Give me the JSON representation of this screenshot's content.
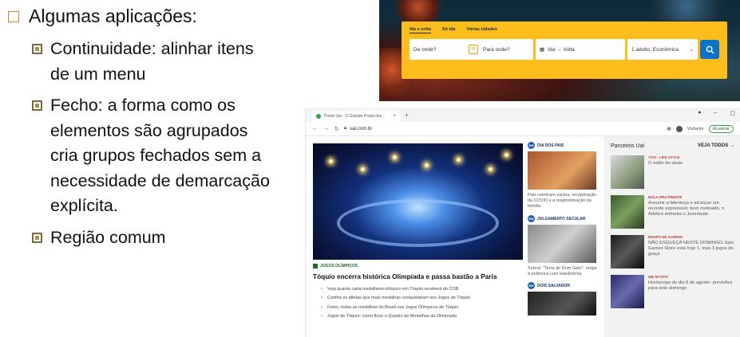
{
  "slide": {
    "heading": "Algumas aplicações:",
    "items": [
      "Continuidade: alinhar itens de um menu",
      "Fecho: a forma como os elementos são agrupados cria grupos fechados sem a necessidade de demarcação explícita.",
      "Região comum"
    ]
  },
  "flight": {
    "tabs": [
      "Ida e volta",
      "Só ida",
      "Várias cidades"
    ],
    "origin_placeholder": "De onde?",
    "destination_placeholder": "Para onde?",
    "dates_label": "Ida → Volta",
    "passengers_label": "1 adulto, Econômica",
    "swap_icon": "swap-icon",
    "search_icon": "search-icon",
    "accent": "#fdbe1d",
    "button_color": "#0a73c8"
  },
  "browser": {
    "tab_title": "Portal Uai - O Grande Portal dos...",
    "url": "uai.com.br",
    "profile_label": "Visitante",
    "update_label": "Atualizar",
    "hero_tag": "JOGOS OLÍMPICOS",
    "headline": "Tóquio encerra histórica Olimpíada e passa bastão a Paris",
    "related": [
      "Veja quanto cada medalhista olímpico em Tóquio receberá do COB",
      "Confira os atletas que mais medalhas conquistaram nos Jogos de Tóquio",
      "Fotos: todas as medalhas do Brasil nos Jogos Olímpicos de Tóquio",
      "Jogos de Tóquio: como ficou o Quadro de Medalhas da Olimpíada"
    ],
    "middle": [
      {
        "badge": "EM",
        "tag": "DIA DOS PAIS",
        "caption": "Pais celebram vacina, recuperação da COVID e a reaproximação da família"
      },
      {
        "badge": "EM",
        "tag": "JULGAMENTO SECULAR",
        "caption": "Sobral, \"Terra de Dom Gato\", reage à polêmica com banderinha"
      },
      {
        "badge": "EM",
        "tag": "DOIS SALVADOR",
        "caption": ""
      }
    ],
    "partners": {
      "title": "Parceiros Uai",
      "see_all": "VEJA TODOS →",
      "items": [
        {
          "tag": "YOO - LIFE STYLE",
          "text": "O estilo do skate"
        },
        {
          "tag": "BOLA PRA FRENTE",
          "text": "Assumir a liderança e alcançar um recorde expressivo: bem motivado, o Atlético enfrenta o Juventude"
        },
        {
          "tag": "DROPS DE GAMING",
          "text": "NÃO ESQUEÇA NESTE DOMINGO: Epic Games Store está hoje 1, mas 3 jogos de graça"
        },
        {
          "tag": "WE MYSTIC",
          "text": "Horóscopo do dia 8 de agosto: previsões para este domingo"
        }
      ]
    }
  }
}
